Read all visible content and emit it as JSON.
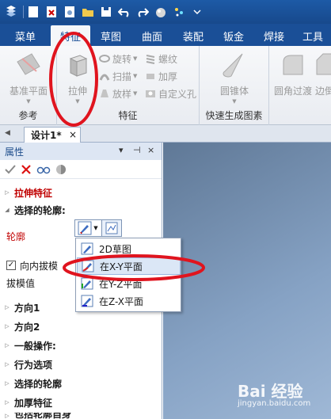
{
  "ribbon_tabs": [
    {
      "label": "菜单"
    },
    {
      "label": "特征"
    },
    {
      "label": "草图"
    },
    {
      "label": "曲面"
    },
    {
      "label": "装配"
    },
    {
      "label": "钣金"
    },
    {
      "label": "焊接"
    },
    {
      "label": "工具"
    }
  ],
  "ribbon": {
    "reference_group": {
      "label": "参考",
      "datum_plane": "基准平面"
    },
    "feature_group": {
      "label": "特征",
      "extrude": "拉伸",
      "revolve": "旋转",
      "thread": "螺纹",
      "sweep": "扫描",
      "thicken": "加厚",
      "loft": "放样",
      "custom_hole": "自定义孔"
    },
    "quick_group": {
      "label": "快速生成图素",
      "cone": "圆锥体"
    },
    "fillet": "圆角过渡",
    "edge": "边倒"
  },
  "document_tab": {
    "title": "设计1*",
    "close": "×"
  },
  "panel": {
    "title": "属性",
    "ctrl_pin": "▾",
    "ctrl_dock": "⊣",
    "ctrl_close": "×",
    "extrude_feature": "拉伸特征",
    "selected_profile_header": "选择的轮廓:",
    "profile_label": "轮廓",
    "inward_draft": "向内拔模",
    "draft_value": "拔模值",
    "sections": [
      "方向1",
      "方向2",
      "一般操作:",
      "行为选项",
      "选择的轮廓",
      "加厚特征"
    ],
    "cut_off": "包括轮廓自身"
  },
  "profile_menu": [
    {
      "label": "2D草图",
      "icon": "sketch-2d-icon"
    },
    {
      "label": "在X-Y平面",
      "icon": "xy-plane-icon"
    },
    {
      "label": "在Y-Z平面",
      "icon": "yz-plane-icon"
    },
    {
      "label": "在Z-X平面",
      "icon": "zx-plane-icon"
    }
  ],
  "watermark": {
    "brand": "Bai 经验",
    "url": "jingyan.baidu.com"
  },
  "colors": {
    "accent": "#1a4f97",
    "annotation": "#e0141e",
    "feature_red": "#c00000"
  }
}
